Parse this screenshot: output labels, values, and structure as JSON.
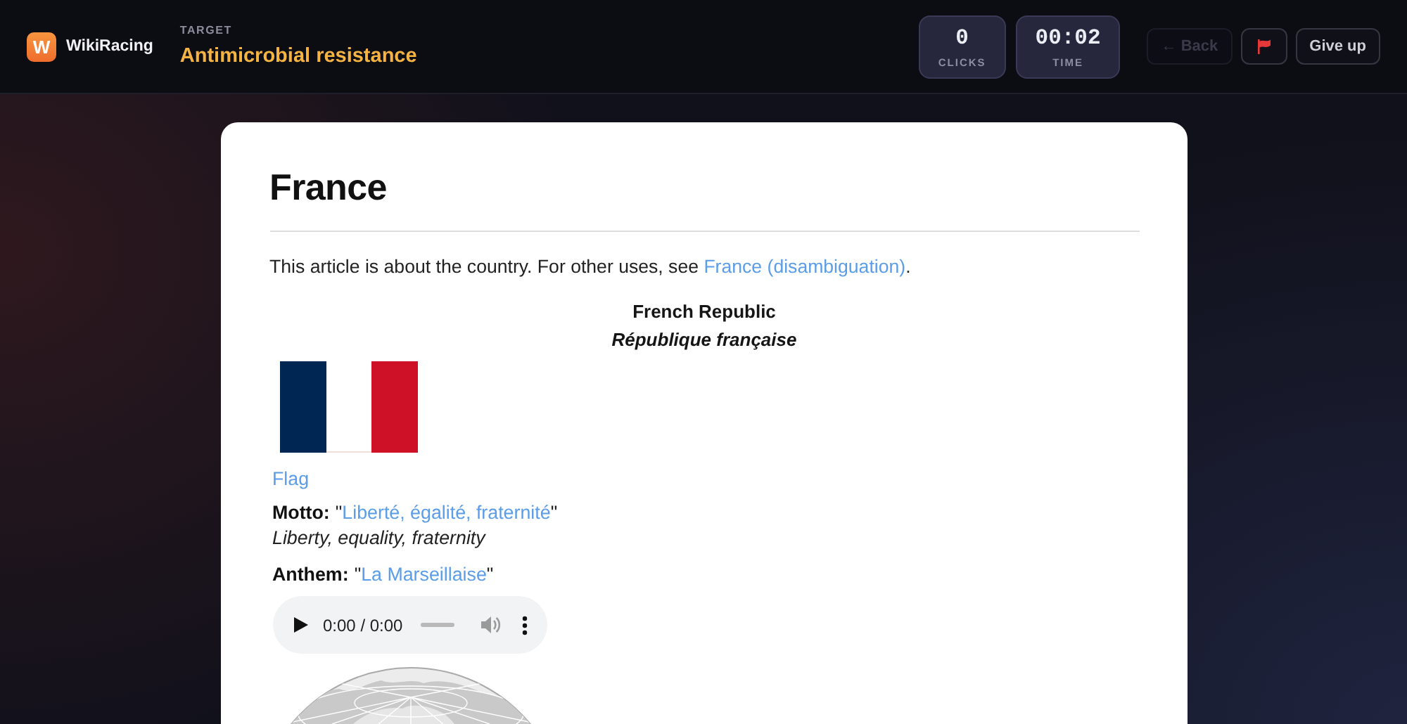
{
  "header": {
    "logo_letter": "W",
    "app_name": "WikiRacing",
    "target": {
      "label": "TARGET",
      "title": "Antimicrobial resistance"
    }
  },
  "stats": [
    {
      "value": "0",
      "label": "CLICKS"
    },
    {
      "value": "00:02",
      "label": "TIME"
    }
  ],
  "actions": [
    {
      "kind": "back",
      "label": "← Back",
      "disabled": true
    },
    {
      "kind": "flag",
      "disabled": false
    },
    {
      "kind": "give_up",
      "label": "Give up",
      "disabled": false
    }
  ],
  "article": {
    "title": "France",
    "hatnote": {
      "text_before": "This article is about the country. For other uses, see ",
      "link": "France (disambiguation)",
      "text_after": "."
    },
    "infobox": {
      "name": "French Republic",
      "native_name": "République française",
      "flag_caption": "Flag",
      "motto": {
        "label": "Motto:",
        "open_quote": "\"",
        "link": "Liberté, égalité, fraternité",
        "close_quote": "\"",
        "translation": "Liberty, equality, fraternity"
      },
      "anthem": {
        "label": "Anthem:",
        "open_quote": "\"",
        "link": "La Marseillaise",
        "close_quote": "\""
      },
      "audio": {
        "time": "0:00 / 0:00",
        "seek": {
          "level": 0
        }
      }
    }
  }
}
